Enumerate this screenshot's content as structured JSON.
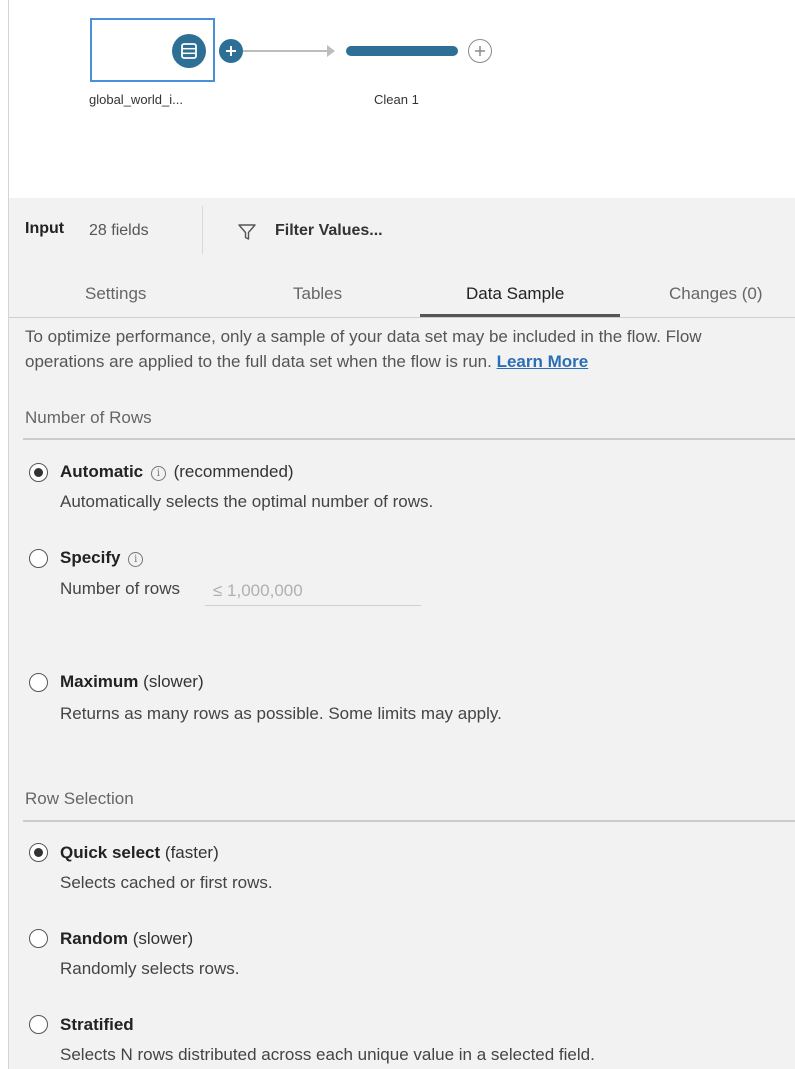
{
  "flow": {
    "input_node_label": "global_world_i...",
    "clean_node_label": "Clean 1"
  },
  "panel": {
    "title": "Input",
    "field_count": "28 fields",
    "filter_label": "Filter Values...",
    "tabs": [
      {
        "label": "Settings",
        "active": false
      },
      {
        "label": "Tables",
        "active": false
      },
      {
        "label": "Data Sample",
        "active": true
      },
      {
        "label": "Changes (0)",
        "active": false
      }
    ],
    "intro_text": "To optimize performance, only a sample of your data set may be included in the flow. Flow operations are applied to the full data set when the flow is run.",
    "learn_more": "Learn More"
  },
  "number_of_rows": {
    "header": "Number of Rows",
    "options": [
      {
        "title": "Automatic",
        "suffix": "(recommended)",
        "description": "Automatically selects the optimal number of rows.",
        "checked": true
      },
      {
        "title": "Specify",
        "suffix": "",
        "description": "",
        "checked": false
      },
      {
        "title": "Maximum",
        "suffix": "(slower)",
        "description": "Returns as many rows as possible. Some limits may apply.",
        "checked": false
      }
    ],
    "rows_field_label": "Number of rows",
    "rows_field_placeholder": "≤ 1,000,000"
  },
  "row_selection": {
    "header": "Row Selection",
    "options": [
      {
        "title": "Quick select",
        "suffix": "(faster)",
        "description": "Selects cached or first rows.",
        "checked": true
      },
      {
        "title": "Random",
        "suffix": "(slower)",
        "description": "Randomly selects rows.",
        "checked": false
      },
      {
        "title": "Stratified",
        "suffix": "",
        "description": "Selects N rows distributed across each unique value in a selected field.",
        "checked": false
      }
    ]
  },
  "colors": {
    "node_accent": "#2e6f95",
    "selection_border": "#4a90d9",
    "link": "#2a6fb5",
    "panel_bg": "#f2f2f2"
  },
  "icons": {
    "input_node": "database-table-icon",
    "add": "plus-icon",
    "filter": "funnel-icon",
    "info": "info-icon"
  }
}
